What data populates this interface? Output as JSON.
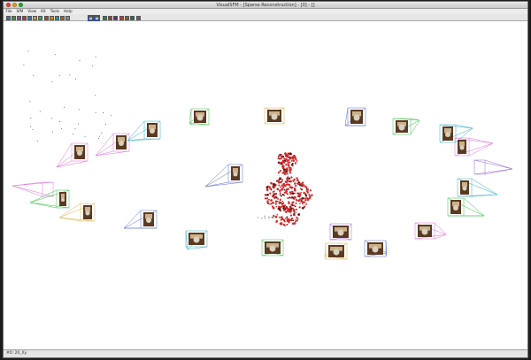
{
  "window": {
    "title": "VisualSFM - [Sparse Reconstruction] - [0] - []"
  },
  "menubar": {
    "items": [
      "File",
      "SfM",
      "View",
      "Kit",
      "Tools",
      "Help"
    ]
  },
  "toolbar": {
    "buttons": [
      {
        "icon": "open-icon",
        "color": "#3a6fb5"
      },
      {
        "icon": "save-icon",
        "color": "#3a8f3a"
      },
      {
        "icon": "load-nvm-icon",
        "color": "#8a4f9e"
      },
      {
        "icon": "images-icon",
        "color": "#c0392b"
      },
      {
        "icon": "feature-icon",
        "color": "#2a7ab9"
      },
      {
        "icon": "match-icon",
        "color": "#d4a017"
      },
      {
        "icon": "match-view-icon",
        "color": "#27ae60"
      },
      {
        "icon": "sfm-icon",
        "color": "#c0392b"
      },
      {
        "icon": "dense-icon",
        "color": "#e67e22"
      },
      {
        "icon": "grid-icon",
        "color": "#16a085"
      },
      {
        "icon": "camera-icon",
        "color": "#d35400"
      },
      {
        "icon": "points-icon",
        "color": "#7f8c8d"
      },
      {
        "icon": "toggle-3d-icon",
        "color": "#a93226",
        "active": true
      },
      {
        "icon": "cmvs-icon",
        "color": "#2471a3",
        "active": true
      },
      {
        "icon": "select-icon",
        "color": "#1e8449"
      },
      {
        "icon": "delete-icon",
        "color": "#b03a2e"
      },
      {
        "icon": "flip-icon",
        "color": "#5b2c6f"
      },
      {
        "icon": "stop-icon",
        "color": "#c0392b"
      },
      {
        "icon": "pause-icon",
        "color": "#7d6608"
      },
      {
        "icon": "log-icon",
        "color": "#117864"
      },
      {
        "icon": "settings-icon",
        "color": "#566573"
      }
    ]
  },
  "statusbar": {
    "text": "#0: 20_Xy"
  },
  "scene": {
    "point_color": "#d42a2a",
    "frustum_colors": [
      "#5b6fd6",
      "#3bbf4a",
      "#e070d8",
      "#2fb0c7",
      "#d6b24a",
      "#9a6ad4"
    ]
  }
}
